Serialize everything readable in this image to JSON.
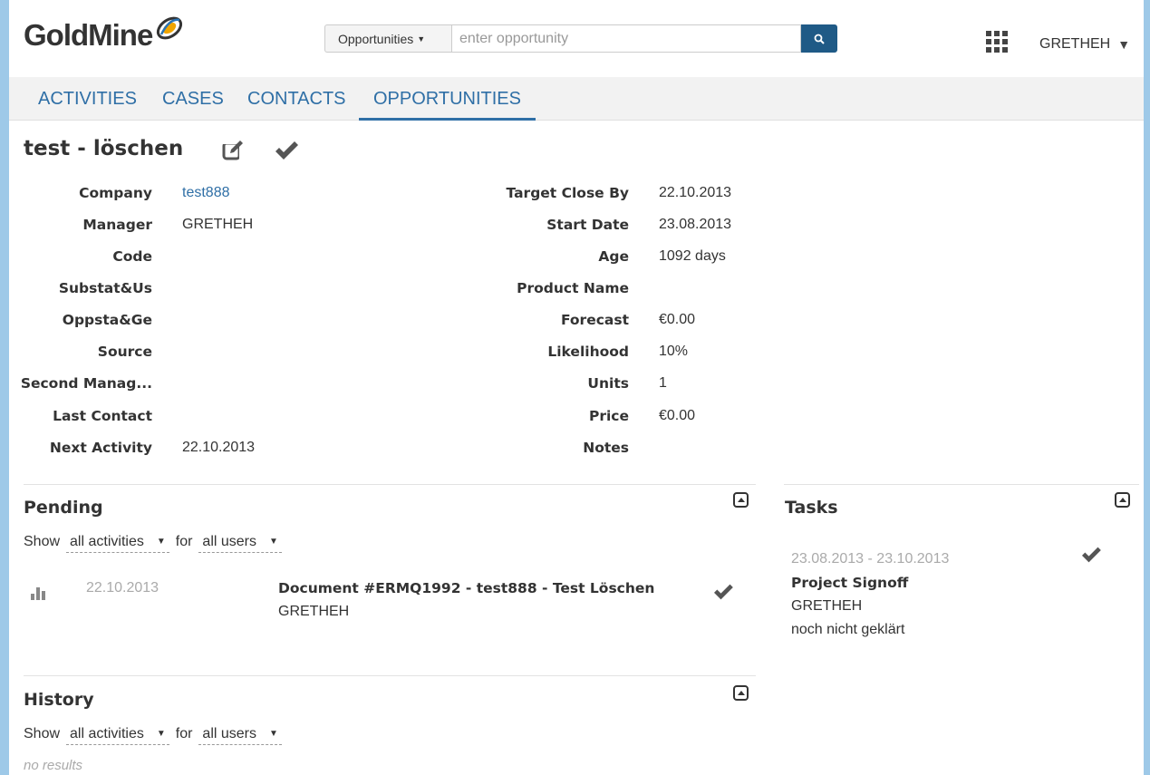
{
  "header": {
    "logo_text": "GoldMine",
    "search_type": "Opportunities",
    "search_placeholder": "enter opportunity",
    "user": "GRETHEH"
  },
  "nav": {
    "tabs": [
      {
        "label": "ACTIVITIES",
        "active": false
      },
      {
        "label": "CASES",
        "active": false
      },
      {
        "label": "CONTACTS",
        "active": false
      },
      {
        "label": "OPPORTUNITIES",
        "active": true
      }
    ]
  },
  "record": {
    "title": "test - löschen",
    "left_fields": [
      {
        "label": "Company",
        "value": "test888"
      },
      {
        "label": "Manager",
        "value": "GRETHEH"
      },
      {
        "label": "Code",
        "value": ""
      },
      {
        "label": "Substat&Us",
        "value": ""
      },
      {
        "label": "Oppsta&Ge",
        "value": ""
      },
      {
        "label": "Source",
        "value": ""
      },
      {
        "label": "Second Manag...",
        "value": ""
      },
      {
        "label": "Last Contact",
        "value": ""
      },
      {
        "label": "Next Activity",
        "value": "22.10.2013"
      }
    ],
    "right_fields": [
      {
        "label": "Target Close By",
        "value": "22.10.2013"
      },
      {
        "label": "Start Date",
        "value": "23.08.2013"
      },
      {
        "label": "Age",
        "value": "1092 days"
      },
      {
        "label": "Product Name",
        "value": ""
      },
      {
        "label": "Forecast",
        "value": "€0.00"
      },
      {
        "label": "Likelihood",
        "value": "10%"
      },
      {
        "label": "Units",
        "value": "1"
      },
      {
        "label": "Price",
        "value": "€0.00"
      },
      {
        "label": "Notes",
        "value": ""
      }
    ]
  },
  "pending": {
    "title": "Pending",
    "show_label": "Show",
    "activity_filter": "all activities",
    "for_label": "for",
    "user_filter": "all users",
    "items": [
      {
        "date": "22.10.2013",
        "title": "Document #ERMQ1992 - test888 - Test Löschen",
        "user": "GRETHEH"
      }
    ]
  },
  "tasks": {
    "title": "Tasks",
    "items": [
      {
        "date_range": "23.08.2013 - 23.10.2013",
        "title": "Project Signoff",
        "user": "GRETHEH",
        "status": "noch nicht geklärt"
      }
    ]
  },
  "history": {
    "title": "History",
    "show_label": "Show",
    "activity_filter": "all activities",
    "for_label": "for",
    "user_filter": "all users",
    "empty_text": "no results"
  },
  "colors": {
    "accent": "#2f6fa6",
    "search_button": "#1f5a86",
    "page_border": "#9ec9e8"
  }
}
